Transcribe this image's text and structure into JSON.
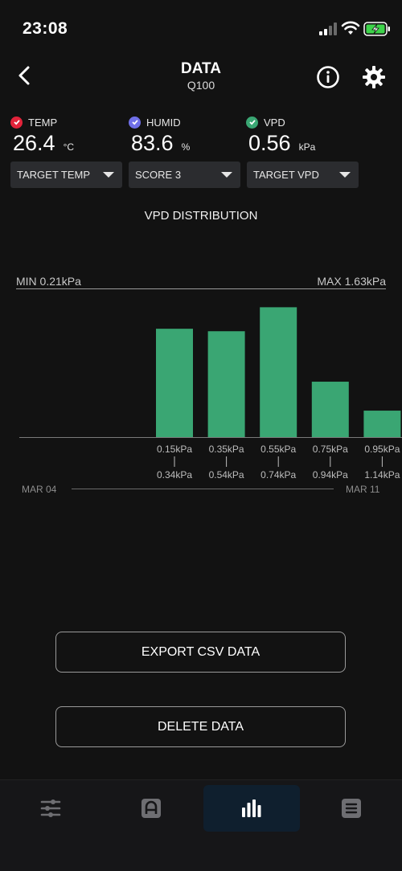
{
  "status_bar": {
    "time": "23:08"
  },
  "header": {
    "title": "DATA",
    "subtitle": "Q100"
  },
  "metrics": [
    {
      "label": "TEMP",
      "value": "26.4",
      "unit": "°C",
      "color": "#e2233a"
    },
    {
      "label": "HUMID",
      "value": "83.6",
      "unit": "%",
      "color": "#6f6fe8"
    },
    {
      "label": "VPD",
      "value": "0.56",
      "unit": "kPa",
      "color": "#3aa673"
    }
  ],
  "dropdowns": [
    {
      "label": "TARGET TEMP"
    },
    {
      "label": "SCORE 3"
    },
    {
      "label": "TARGET VPD"
    }
  ],
  "chart_title": "VPD DISTRIBUTION",
  "range": {
    "min": "MIN 0.21kPa",
    "max": "MAX 1.63kPa"
  },
  "dates": {
    "start": "MAR 04",
    "end": "MAR 11"
  },
  "chart_data": {
    "type": "bar",
    "title": "VPD DISTRIBUTION",
    "bar_color": "#3aa673",
    "categories": [
      {
        "low": "0.15kPa",
        "high": "0.34kPa"
      },
      {
        "low": "0.35kPa",
        "high": "0.54kPa"
      },
      {
        "low": "0.55kPa",
        "high": "0.74kPa"
      },
      {
        "low": "0.75kPa",
        "high": "0.94kPa"
      },
      {
        "low": "0.95kPa",
        "high": "1.14kPa"
      }
    ],
    "values": [
      131,
      128,
      157,
      67,
      32
    ],
    "ylim": [
      0,
      170
    ]
  },
  "actions": {
    "export_label": "EXPORT CSV DATA",
    "delete_label": "DELETE DATA"
  },
  "nav": [
    {
      "icon": "sliders-icon",
      "active": false
    },
    {
      "icon": "controller-icon",
      "active": false
    },
    {
      "icon": "bar-chart-icon",
      "active": true
    },
    {
      "icon": "list-icon",
      "active": false
    }
  ],
  "colors": {
    "accent": "#3aa673",
    "background": "#121212",
    "dropdown_bg": "#2b2c2f",
    "active_tab": "#0f1f2e"
  }
}
